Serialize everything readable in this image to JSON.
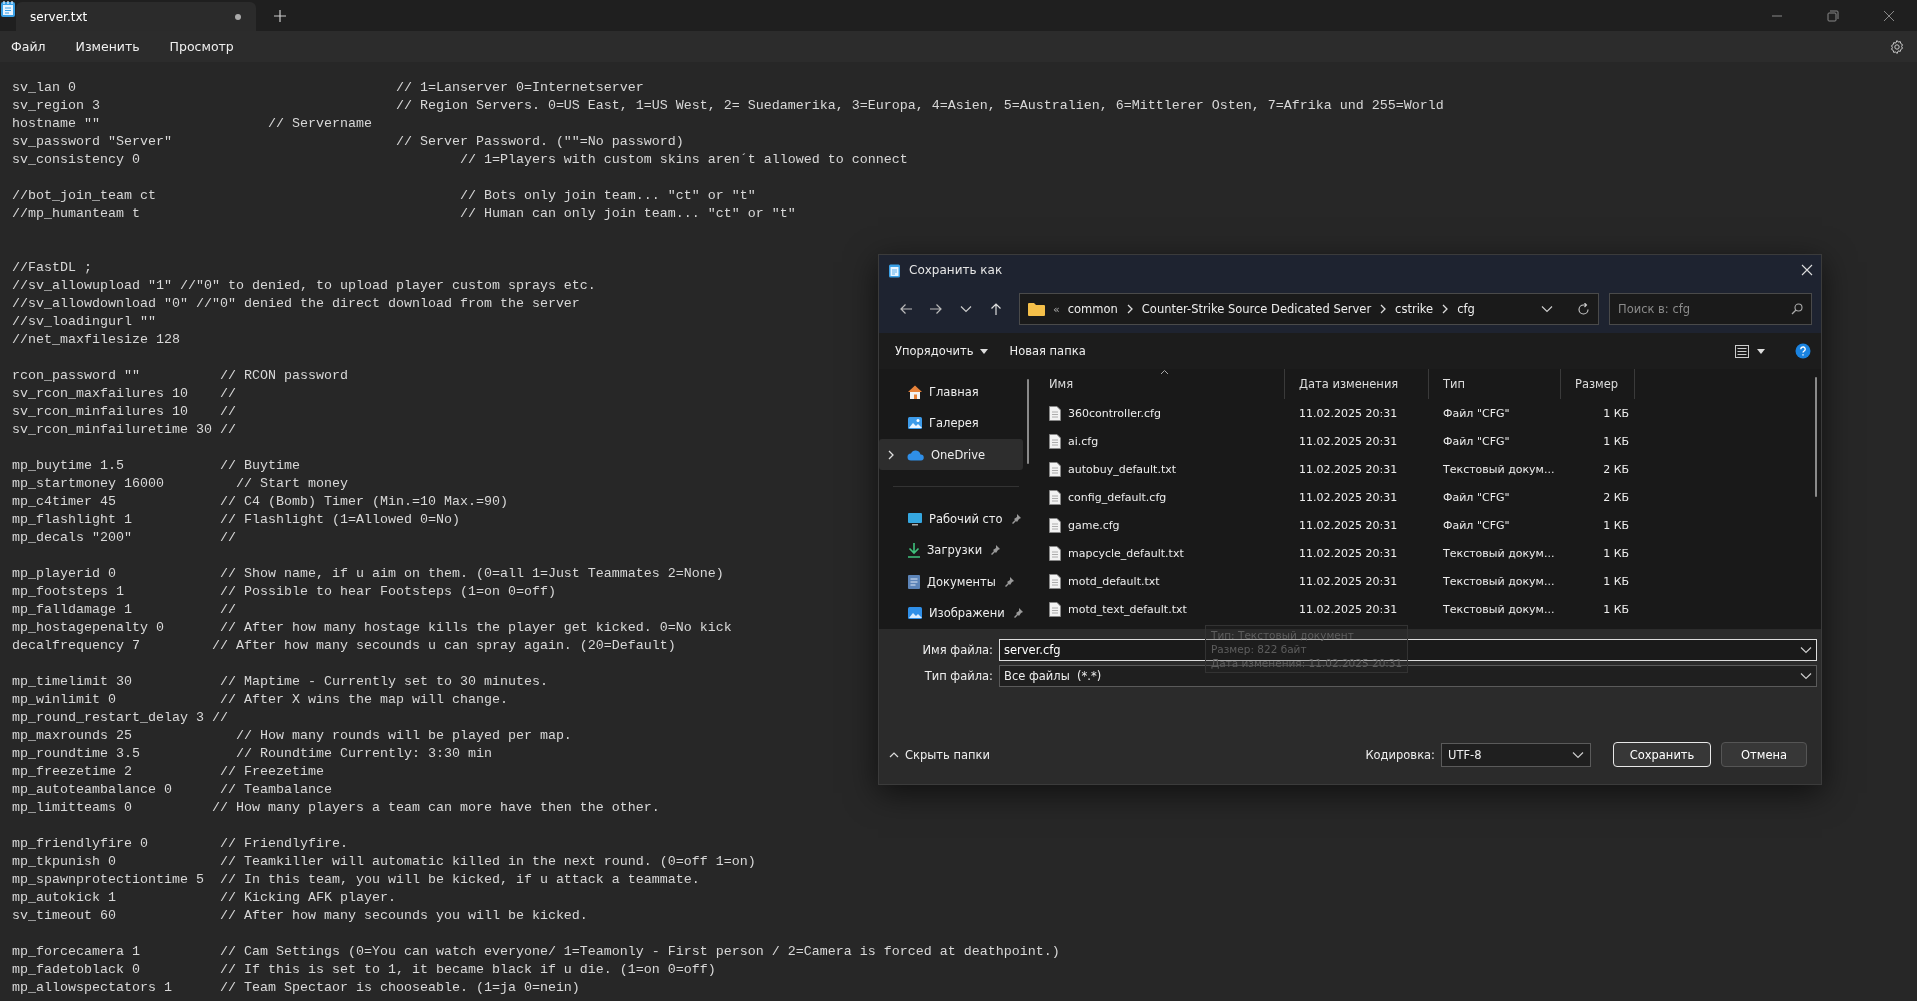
{
  "app": {
    "tab_title": "server.txt",
    "unsaved": true
  },
  "menu": [
    "Файл",
    "Изменить",
    "Просмотр"
  ],
  "editor": {
    "lines": [
      {
        "kind": "code",
        "text": "sv_lan 0                                        // 1=Lanserver 0=Internetserver"
      },
      {
        "kind": "code",
        "text": "sv_region 3                                     // Region Servers. 0=US East, 1=US West, 2= Suedamerika, 3=Europa, 4=Asien, 5=Australien, 6=Mittlerer Osten, 7=Afrika und 255=World"
      },
      {
        "kind": "code",
        "text": "hostname \"\"                     // Servername"
      },
      {
        "kind": "code",
        "text": "sv_password \"Server\"                            // Server Password. (\"\"=No password)"
      },
      {
        "kind": "code",
        "text": "sv_consistency 0                                        // 1=Players with custom skins aren´t allowed to connect"
      },
      {
        "kind": "blank"
      },
      {
        "kind": "code",
        "text": "//bot_join_team ct                                      // Bots only join team... \"ct\" or \"t\""
      },
      {
        "kind": "code",
        "text": "//mp_humanteam t                                        // Human can only join team... \"ct\" or \"t\""
      },
      {
        "kind": "blank"
      },
      {
        "kind": "blank"
      },
      {
        "kind": "code",
        "text": "//FastDL ;"
      },
      {
        "kind": "code",
        "text": "//sv_allowupload \"1\" //\"0\" to denied, to upload player custom sprays etc."
      },
      {
        "kind": "code",
        "text": "//sv_allowdownload \"0\" //\"0\" denied the direct download from the server"
      },
      {
        "kind": "code",
        "text": "//sv_loadingurl \"\""
      },
      {
        "kind": "code",
        "text": "//net_maxfilesize 128"
      },
      {
        "kind": "blank"
      },
      {
        "kind": "code",
        "text": "rcon_password \"\"          // RCON password"
      },
      {
        "kind": "code",
        "text": "sv_rcon_maxfailures 10    //"
      },
      {
        "kind": "code",
        "text": "sv_rcon_minfailures 10    //"
      },
      {
        "kind": "code",
        "text": "sv_rcon_minfailuretime 30 //"
      },
      {
        "kind": "blank"
      },
      {
        "kind": "code",
        "text": "mp_buytime 1.5            // Buytime"
      },
      {
        "kind": "code",
        "text": "mp_startmoney 16000         // Start money"
      },
      {
        "kind": "code",
        "text": "mp_c4timer 45             // C4 (Bomb) Timer (Min.=10 Max.=90)"
      },
      {
        "kind": "code",
        "text": "mp_flashlight 1           // Flashlight (1=Allowed 0=No)"
      },
      {
        "kind": "code",
        "text": "mp_decals \"200\"           //"
      },
      {
        "kind": "blank"
      },
      {
        "kind": "code",
        "text": "mp_playerid 0             // Show name, if u aim on them. (0=all 1=Just Teammates 2=None)"
      },
      {
        "kind": "code",
        "text": "mp_footsteps 1            // Possible to hear Footsteps (1=on 0=off)"
      },
      {
        "kind": "code",
        "text": "mp_falldamage 1           //"
      },
      {
        "kind": "code",
        "text": "mp_hostagepenalty 0       // After how many hostage kills the player get kicked. 0=No kick"
      },
      {
        "kind": "code",
        "text": "decalfrequency 7         // After how many secounds u can spray again. (20=Default)"
      },
      {
        "kind": "blank"
      },
      {
        "kind": "code",
        "text": "mp_timelimit 30           // Maptime - Currently set to 30 minutes."
      },
      {
        "kind": "code",
        "text": "mp_winlimit 0             // After X wins the map will change."
      },
      {
        "kind": "code",
        "text": "mp_round_restart_delay 3 //"
      },
      {
        "kind": "code",
        "text": "mp_maxrounds 25             // How many rounds will be played per map."
      },
      {
        "kind": "code",
        "text": "mp_roundtime 3.5            // Roundtime Currently: 3:30 min"
      },
      {
        "kind": "code",
        "text": "mp_freezetime 2           // Freezetime"
      },
      {
        "kind": "code",
        "text": "mp_autoteambalance 0      // Teambalance"
      },
      {
        "kind": "code",
        "text": "mp_limitteams 0          // How many players a team can more have then the other."
      },
      {
        "kind": "blank"
      },
      {
        "kind": "code",
        "text": "mp_friendlyfire 0         // Friendlyfire."
      },
      {
        "kind": "code",
        "text": "mp_tkpunish 0             // Teamkiller will automatic killed in the next round. (0=off 1=on)"
      },
      {
        "kind": "code",
        "text": "mp_spawnprotectiontime 5  // In this team, you will be kicked, if u attack a teammate."
      },
      {
        "kind": "code",
        "text": "mp_autokick 1             // Kicking AFK player."
      },
      {
        "kind": "code",
        "text": "sv_timeout 60             // After how many secounds you will be kicked."
      },
      {
        "kind": "blank"
      },
      {
        "kind": "code",
        "text": "mp_forcecamera 1          // Cam Settings (0=You can watch everyone/ 1=Teamonly - First person / 2=Camera is forced at deathpoint.)"
      },
      {
        "kind": "code",
        "text": "mp_fadetoblack 0          // If this is set to 1, it became black if u die. (1=on 0=off)"
      },
      {
        "kind": "code",
        "text": "mp_allowspectators 1      // Team Spectaor is chooseable. (1=ja 0=nein)"
      }
    ]
  },
  "dialog": {
    "title": "Сохранить как",
    "path_overflow": "«",
    "path": [
      "common",
      "Counter-Strike Source Dedicated Server",
      "cstrike",
      "cfg"
    ],
    "search_placeholder": "Поиск в: cfg",
    "organize": "Упорядочить",
    "new_folder": "Новая папка",
    "sidebar": [
      {
        "label": "Главная",
        "kind": "home",
        "selected": false,
        "pinned": false,
        "expandable": false,
        "separator_before": false
      },
      {
        "label": "Галерея",
        "kind": "gallery",
        "selected": false,
        "pinned": false,
        "expandable": false,
        "separator_before": false
      },
      {
        "label": "OneDrive",
        "kind": "cloud",
        "selected": true,
        "pinned": false,
        "expandable": true,
        "separator_before": false
      },
      {
        "label": "Рабочий сто",
        "kind": "desktop",
        "selected": false,
        "pinned": true,
        "expandable": false,
        "separator_before": true
      },
      {
        "label": "Загрузки",
        "kind": "downloads",
        "selected": false,
        "pinned": true,
        "expandable": false,
        "separator_before": false
      },
      {
        "label": "Документы",
        "kind": "documents",
        "selected": false,
        "pinned": true,
        "expandable": false,
        "separator_before": false
      },
      {
        "label": "Изображени",
        "kind": "pictures",
        "selected": false,
        "pinned": true,
        "expandable": false,
        "separator_before": false
      }
    ],
    "columns": [
      {
        "label": "Имя",
        "sorted": true
      },
      {
        "label": "Дата изменения",
        "sorted": false
      },
      {
        "label": "Тип",
        "sorted": false
      },
      {
        "label": "Размер",
        "sorted": false
      }
    ],
    "files": [
      {
        "name": "360controller.cfg",
        "date": "11.02.2025 20:31",
        "type": "Файл \"CFG\"",
        "size": "1 КБ"
      },
      {
        "name": "ai.cfg",
        "date": "11.02.2025 20:31",
        "type": "Файл \"CFG\"",
        "size": "1 КБ"
      },
      {
        "name": "autobuy_default.txt",
        "date": "11.02.2025 20:31",
        "type": "Текстовый докум...",
        "size": "2 КБ"
      },
      {
        "name": "config_default.cfg",
        "date": "11.02.2025 20:31",
        "type": "Файл \"CFG\"",
        "size": "2 КБ"
      },
      {
        "name": "game.cfg",
        "date": "11.02.2025 20:31",
        "type": "Файл \"CFG\"",
        "size": "1 КБ"
      },
      {
        "name": "mapcycle_default.txt",
        "date": "11.02.2025 20:31",
        "type": "Текстовый докум...",
        "size": "1 КБ"
      },
      {
        "name": "motd_default.txt",
        "date": "11.02.2025 20:31",
        "type": "Текстовый докум...",
        "size": "1 КБ"
      },
      {
        "name": "motd_text_default.txt",
        "date": "11.02.2025 20:31",
        "type": "Текстовый докум...",
        "size": "1 КБ"
      }
    ],
    "tooltip": [
      "Тип: Текстовый документ",
      "Размер: 822 байт",
      "Дата изменения: 11.02.2025 20:31"
    ],
    "filename_label": "Имя файла:",
    "filename": "server.cfg",
    "filetype_label": "Тип файла:",
    "filetype": "Все файлы  (*.*)",
    "hide_folders": "Скрыть папки",
    "encoding_label": "Кодировка:",
    "encoding": "UTF-8",
    "buttons": [
      {
        "label": "Сохранить",
        "default": true
      },
      {
        "label": "Отмена",
        "default": false
      }
    ]
  }
}
